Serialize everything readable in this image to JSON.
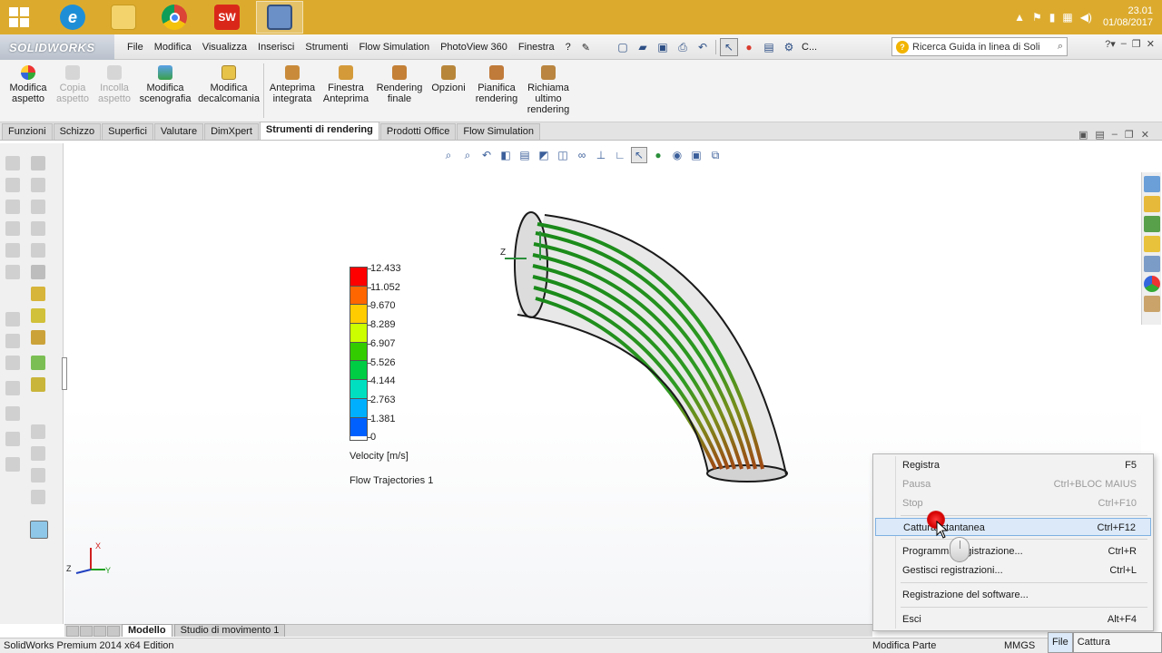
{
  "taskbar": {
    "apps": [
      {
        "name": "start-button",
        "label": ""
      },
      {
        "name": "internet-explorer",
        "label": "e"
      },
      {
        "name": "file-explorer",
        "label": ""
      },
      {
        "name": "chrome",
        "label": ""
      },
      {
        "name": "solidworks",
        "label": "SW"
      },
      {
        "name": "recorder",
        "label": ""
      }
    ],
    "clock_time": "23.01",
    "clock_date": "01/08/2017"
  },
  "app": {
    "logo_text": "SOLIDWORKS",
    "menu": [
      "File",
      "Modifica",
      "Visualizza",
      "Inserisci",
      "Strumenti",
      "Flow Simulation",
      "PhotoView 360",
      "Finestra",
      "?"
    ],
    "quick_more": "C...",
    "search_placeholder": "Ricerca Guida in linea di Soli",
    "search_hint": "?"
  },
  "commands": [
    {
      "label": "Modifica aspetto",
      "enabled": true
    },
    {
      "label": "Copia aspetto",
      "enabled": false
    },
    {
      "label": "Incolla aspetto",
      "enabled": false
    },
    {
      "label": "Modifica scenografia",
      "enabled": true
    },
    {
      "label": "Modifica decalcomania",
      "enabled": true
    },
    {
      "label": "Anteprima integrata",
      "enabled": true
    },
    {
      "label": "Finestra Anteprima",
      "enabled": true
    },
    {
      "label": "Rendering finale",
      "enabled": true
    },
    {
      "label": "Opzioni",
      "enabled": true
    },
    {
      "label": "Pianifica rendering",
      "enabled": true
    },
    {
      "label": "Richiama ultimo rendering",
      "enabled": true
    }
  ],
  "tabs": [
    {
      "label": "Funzioni",
      "active": false
    },
    {
      "label": "Schizzo",
      "active": false
    },
    {
      "label": "Superfici",
      "active": false
    },
    {
      "label": "Valutare",
      "active": false
    },
    {
      "label": "DimXpert",
      "active": false
    },
    {
      "label": "Strumenti di rendering",
      "active": true
    },
    {
      "label": "Prodotti Office",
      "active": false
    },
    {
      "label": "Flow Simulation",
      "active": false
    }
  ],
  "legend": {
    "ticks": [
      "12.433",
      "11.052",
      "9.670",
      "8.289",
      "6.907",
      "5.526",
      "4.144",
      "2.763",
      "1.381",
      "0"
    ],
    "colors": [
      "#ff0000",
      "#ff6600",
      "#ffcc00",
      "#ccff00",
      "#33cc00",
      "#00cc44",
      "#00e0c0",
      "#00b0ff",
      "#0060ff",
      "#0000ff"
    ],
    "title": "Velocity [m/s]",
    "subtitle": "Flow Trajectories 1"
  },
  "triad_labels": {
    "x": "X",
    "y": "Y",
    "z": "Z"
  },
  "model_z_label": "Z",
  "model_tabs": [
    {
      "label": "Modello",
      "active": true
    },
    {
      "label": "Studio di movimento 1",
      "active": false
    }
  ],
  "status": {
    "left": "SolidWorks Premium 2014 x64 Edition",
    "mid": "Modifica Parte",
    "units": "MMGS"
  },
  "context_menu": {
    "items": [
      {
        "label": "Registra",
        "shortcut": "F5",
        "enabled": true,
        "highlight": false
      },
      {
        "label": "Pausa",
        "shortcut": "Ctrl+BLOC MAIUS",
        "enabled": false,
        "highlight": false
      },
      {
        "label": "Stop",
        "shortcut": "Ctrl+F10",
        "enabled": false,
        "highlight": false
      },
      {
        "label": "Cattura istantanea",
        "shortcut": "Ctrl+F12",
        "enabled": true,
        "highlight": true
      },
      {
        "label": "Programma registrazione...",
        "shortcut": "Ctrl+R",
        "enabled": true,
        "highlight": false
      },
      {
        "label": "Gestisci registrazioni...",
        "shortcut": "Ctrl+L",
        "enabled": true,
        "highlight": false
      },
      {
        "label": "Registrazione del software...",
        "shortcut": "",
        "enabled": true,
        "highlight": false
      },
      {
        "label": "Esci",
        "shortcut": "Alt+F4",
        "enabled": true,
        "highlight": false
      }
    ]
  },
  "tray_tabs": {
    "file": "File",
    "capture": "Cattura schermata"
  }
}
